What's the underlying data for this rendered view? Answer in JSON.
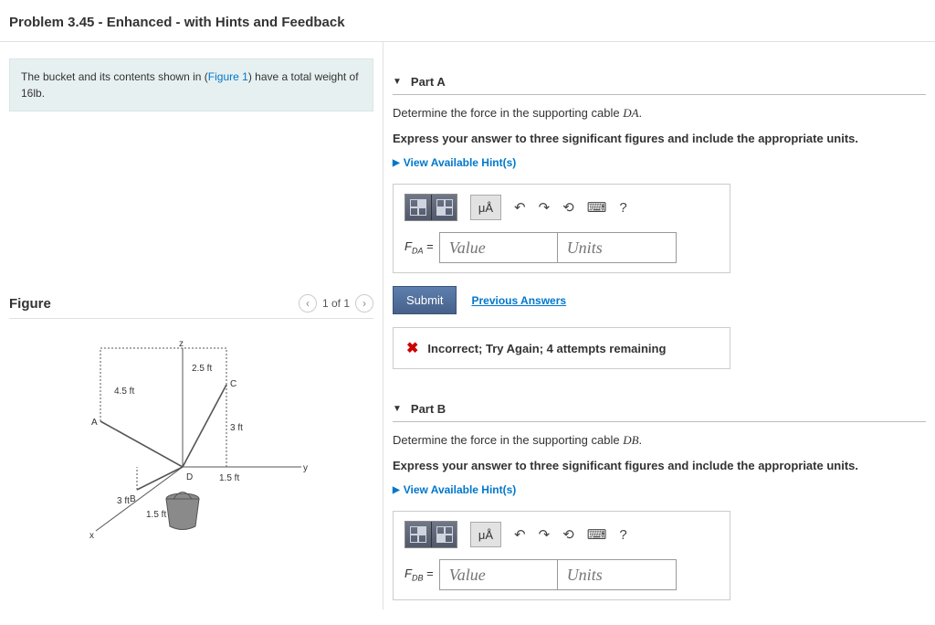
{
  "header": {
    "title": "Problem 3.45 - Enhanced - with Hints and Feedback"
  },
  "intro": {
    "pre": "The bucket and its contents shown in (",
    "link": "Figure 1",
    "post": ") have a total weight of 16lb."
  },
  "figure": {
    "title": "Figure",
    "pager": "1 of 1",
    "labels": {
      "z": "z",
      "y": "y",
      "x": "x",
      "A": "A",
      "B": "B",
      "C": "C",
      "D": "D",
      "d45": "4.5 ft",
      "d25": "2.5 ft",
      "d3": "3 ft",
      "d3b": "3 ft",
      "d15a": "1.5 ft",
      "d15b": "1.5 ft"
    }
  },
  "parts": {
    "a": {
      "title": "Part A",
      "prompt_pre": "Determine the force in the supporting cable ",
      "prompt_var": "DA",
      "prompt_post": ".",
      "instruction": "Express your answer to three significant figures and include the appropriate units.",
      "hints": "View Available Hint(s)",
      "var_label": "F",
      "var_sub": "DA",
      "equals": " = ",
      "value_ph": "Value",
      "units_ph": "Units",
      "submit": "Submit",
      "prev": "Previous Answers",
      "feedback": "Incorrect; Try Again; 4 attempts remaining",
      "ua": "μÅ"
    },
    "b": {
      "title": "Part B",
      "prompt_pre": "Determine the force in the supporting cable ",
      "prompt_var": "DB",
      "prompt_post": ".",
      "instruction": "Express your answer to three significant figures and include the appropriate units.",
      "hints": "View Available Hint(s)",
      "var_label": "F",
      "var_sub": "DB",
      "equals": " = ",
      "value_ph": "Value",
      "units_ph": "Units",
      "ua": "μÅ"
    }
  }
}
